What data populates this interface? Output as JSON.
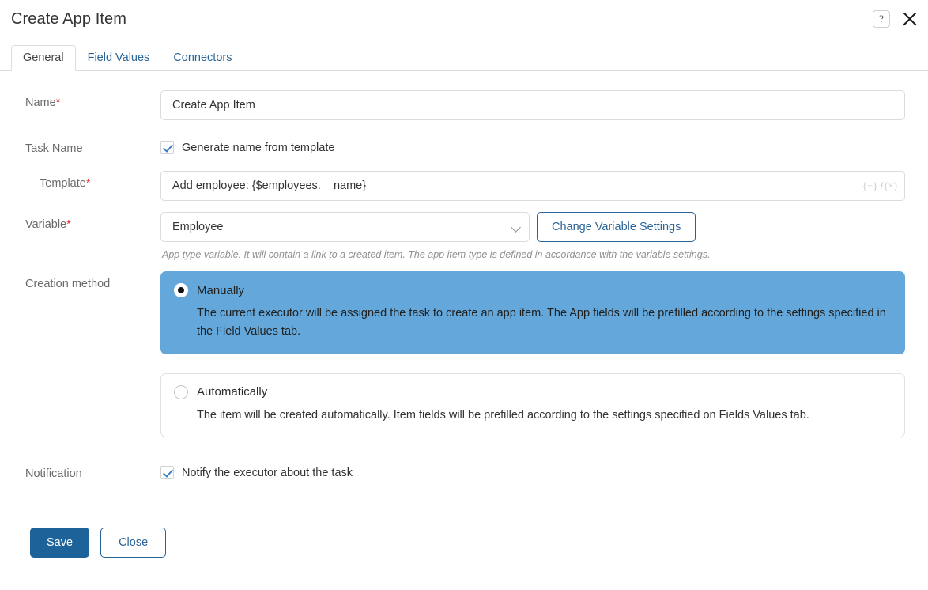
{
  "header": {
    "title": "Create App Item",
    "help_icon": "question-mark-icon",
    "close_icon": "close-icon"
  },
  "tabs": [
    {
      "label": "General",
      "active": true
    },
    {
      "label": "Field Values",
      "active": false
    },
    {
      "label": "Connectors",
      "active": false
    }
  ],
  "form": {
    "name": {
      "label": "Name",
      "required_marker": "*",
      "value": "Create App Item",
      "placeholder": ""
    },
    "task_name": {
      "label": "Task Name",
      "checkbox_label": "Generate name from template",
      "checked": true
    },
    "template": {
      "label": "Template",
      "required_marker": "*",
      "value": "Add employee: {$employees.__name}",
      "placeholder": "",
      "tool_insert_variable": "{+}",
      "tool_function": "ƒ(×)"
    },
    "variable": {
      "label": "Variable",
      "required_marker": "*",
      "selected": "Employee",
      "chevron_icon": "chevron-down-icon",
      "button_label": "Change Variable Settings",
      "hint": "App type variable. It will contain a link to a created item. The app item type is defined in accordance with the variable settings."
    },
    "creation_method": {
      "label": "Creation method",
      "options": [
        {
          "title": "Manually",
          "description": "The current executor will be assigned the task to create an app item. The App fields will be prefilled according to the settings specified in the Field Values tab.",
          "selected": true
        },
        {
          "title": "Automatically",
          "description": "The item will be created automatically. Item fields will be prefilled according to the settings specified on Fields Values tab.",
          "selected": false
        }
      ]
    },
    "notification": {
      "label": "Notification",
      "checkbox_label": "Notify the executor about the task",
      "checked": true
    }
  },
  "footer": {
    "save_label": "Save",
    "close_label": "Close"
  },
  "colors": {
    "accent_blue": "#2a6496",
    "selected_card": "#64a8db",
    "primary_button": "#1d6298",
    "required_red": "#e03131"
  }
}
